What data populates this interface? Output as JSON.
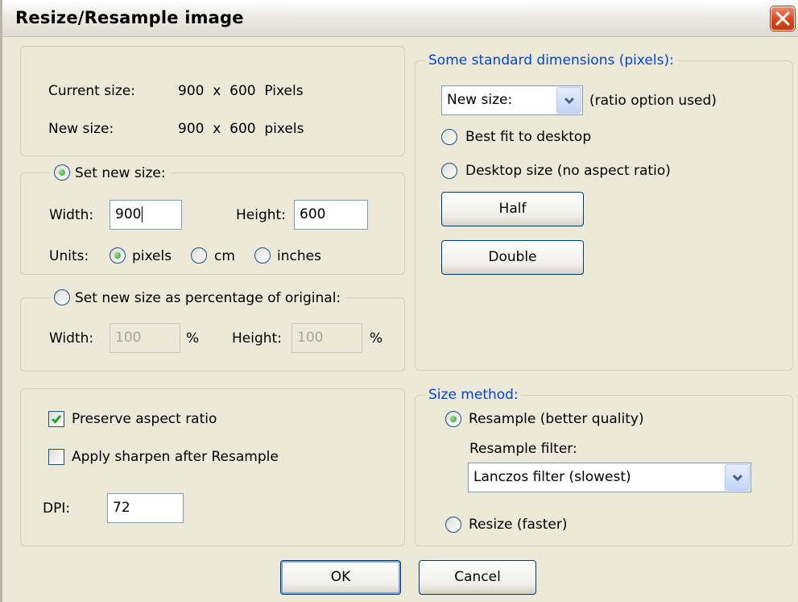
{
  "window": {
    "title": "Resize/Resample image"
  },
  "info": {
    "current_label": "Current size:",
    "current_value": "900  x  600  Pixels",
    "new_label": "New size:",
    "new_value": "900  x  600  pixels"
  },
  "set_size": {
    "radio_label": "Set new size:",
    "width_label": "Width:",
    "width_value": "900",
    "height_label": "Height:",
    "height_value": "600",
    "units_label": "Units:",
    "unit_pixels": "pixels",
    "unit_cm": "cm",
    "unit_inches": "inches"
  },
  "percent": {
    "radio_label": "Set new size as percentage of original:",
    "width_label": "Width:",
    "width_value": "100",
    "height_label": "Height:",
    "height_value": "100",
    "pct": "%"
  },
  "options": {
    "preserve_label": "Preserve aspect ratio",
    "preserve_checked": true,
    "sharpen_label": "Apply sharpen after Resample",
    "sharpen_checked": false,
    "dpi_label": "DPI:",
    "dpi_value": "72"
  },
  "standard": {
    "legend": "Some standard dimensions (pixels):",
    "select_value": "New size:",
    "select_note": "(ratio option used)",
    "best_fit": "Best fit to desktop",
    "desktop_size": "Desktop size (no aspect ratio)",
    "half": "Half",
    "double": "Double"
  },
  "method": {
    "legend": "Size method:",
    "resample": "Resample (better quality)",
    "filter_label": "Resample filter:",
    "filter_value": "Lanczos filter (slowest)",
    "resize": "Resize (faster)"
  },
  "footer": {
    "ok": "OK",
    "cancel": "Cancel"
  },
  "colors": {
    "accent": "#0046d5",
    "face": "#ece9d8",
    "close": "#d9481e"
  }
}
